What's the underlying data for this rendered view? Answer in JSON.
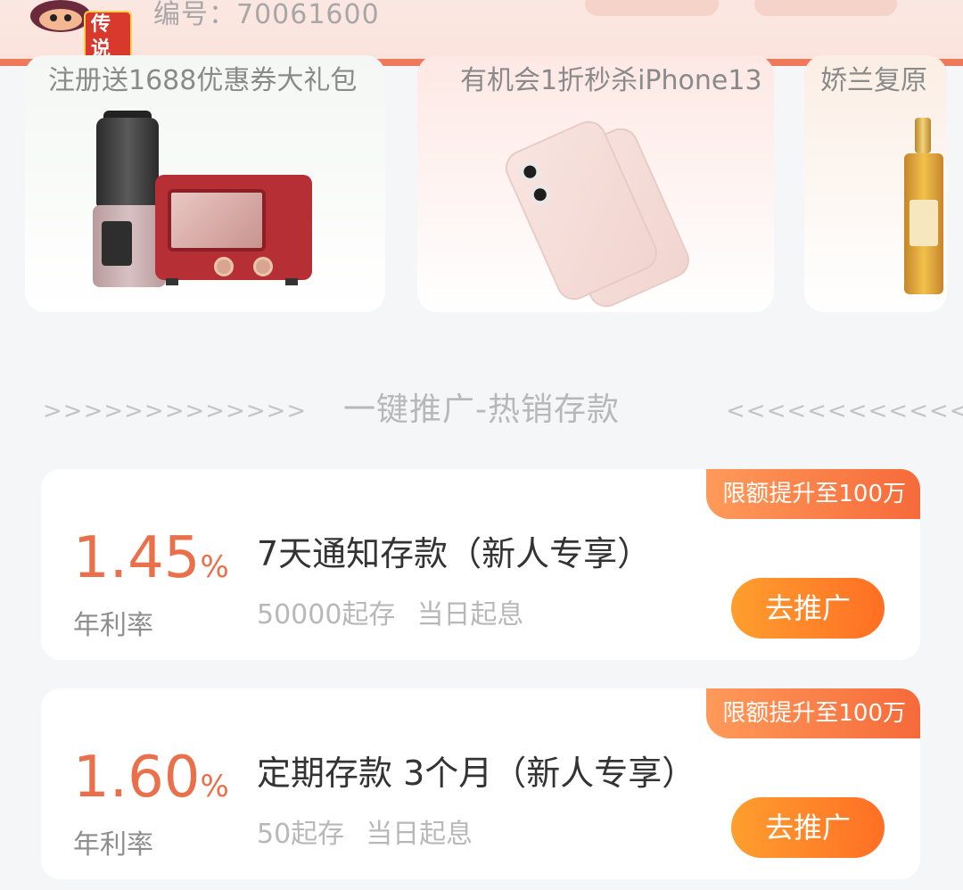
{
  "header": {
    "logo_text": "传说",
    "id_label": "编号：70061600"
  },
  "promos": [
    {
      "title": "注册送1688优惠券大礼包"
    },
    {
      "title": "有机会1折秒杀iPhone13"
    },
    {
      "title": "娇兰复原"
    }
  ],
  "section": {
    "left_arrows": ">>>>>>>>>>>>>",
    "title": "一键推广-热销存款",
    "right_arrows": "<<<<<<<<<<<<<"
  },
  "deposits": [
    {
      "badge": "限额提升至100万",
      "rate": "1.45",
      "rate_unit": "%",
      "rate_label": "年利率",
      "name": "7天通知存款（新人专享）",
      "min_amount": "50000起存",
      "interest_start": "当日起息",
      "button": "去推广"
    },
    {
      "badge": "限额提升至100万",
      "rate": "1.60",
      "rate_unit": "%",
      "rate_label": "年利率",
      "name": "定期存款 3个月（新人专享）",
      "min_amount": "50起存",
      "interest_start": "当日起息",
      "button": "去推广"
    }
  ],
  "colors": {
    "accent": "#e9704a",
    "header_border": "#ef7a5b",
    "button_start": "#ff9e2e",
    "button_end": "#ff6f24"
  }
}
